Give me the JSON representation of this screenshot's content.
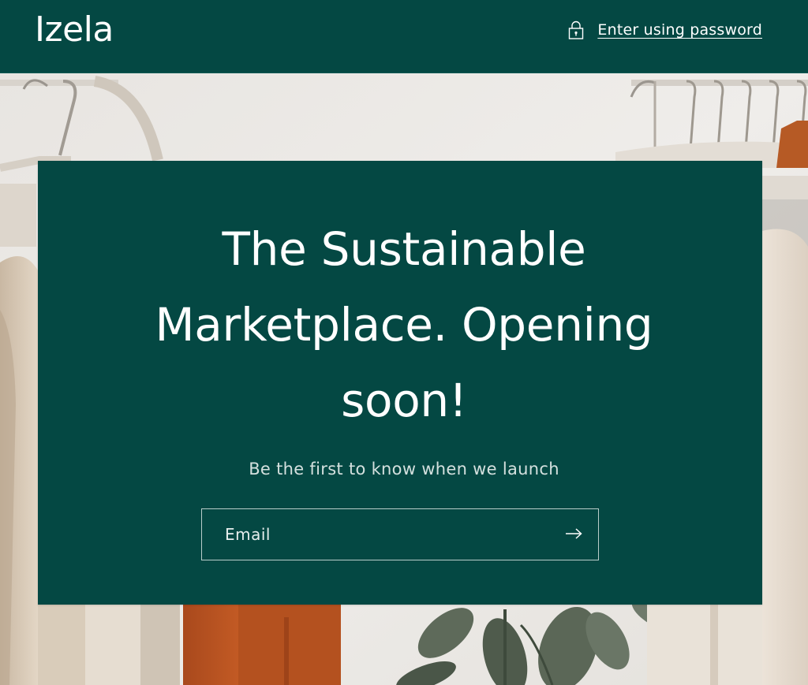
{
  "header": {
    "logo": "Izela",
    "password_link": "Enter using password",
    "password_icon": "lock-icon"
  },
  "hero": {
    "headline_lines": [
      "The Sustainable",
      "Marketplace. Opening",
      "soon!"
    ],
    "subtext": "Be the first to know when we launch",
    "email_placeholder": "Email",
    "email_value": "",
    "submit_icon": "arrow-right-icon"
  },
  "colors": {
    "brand_green": "#044843",
    "text_light": "#ffffff",
    "subtext": "#d4e0de",
    "input_border": "#b9cdca"
  }
}
